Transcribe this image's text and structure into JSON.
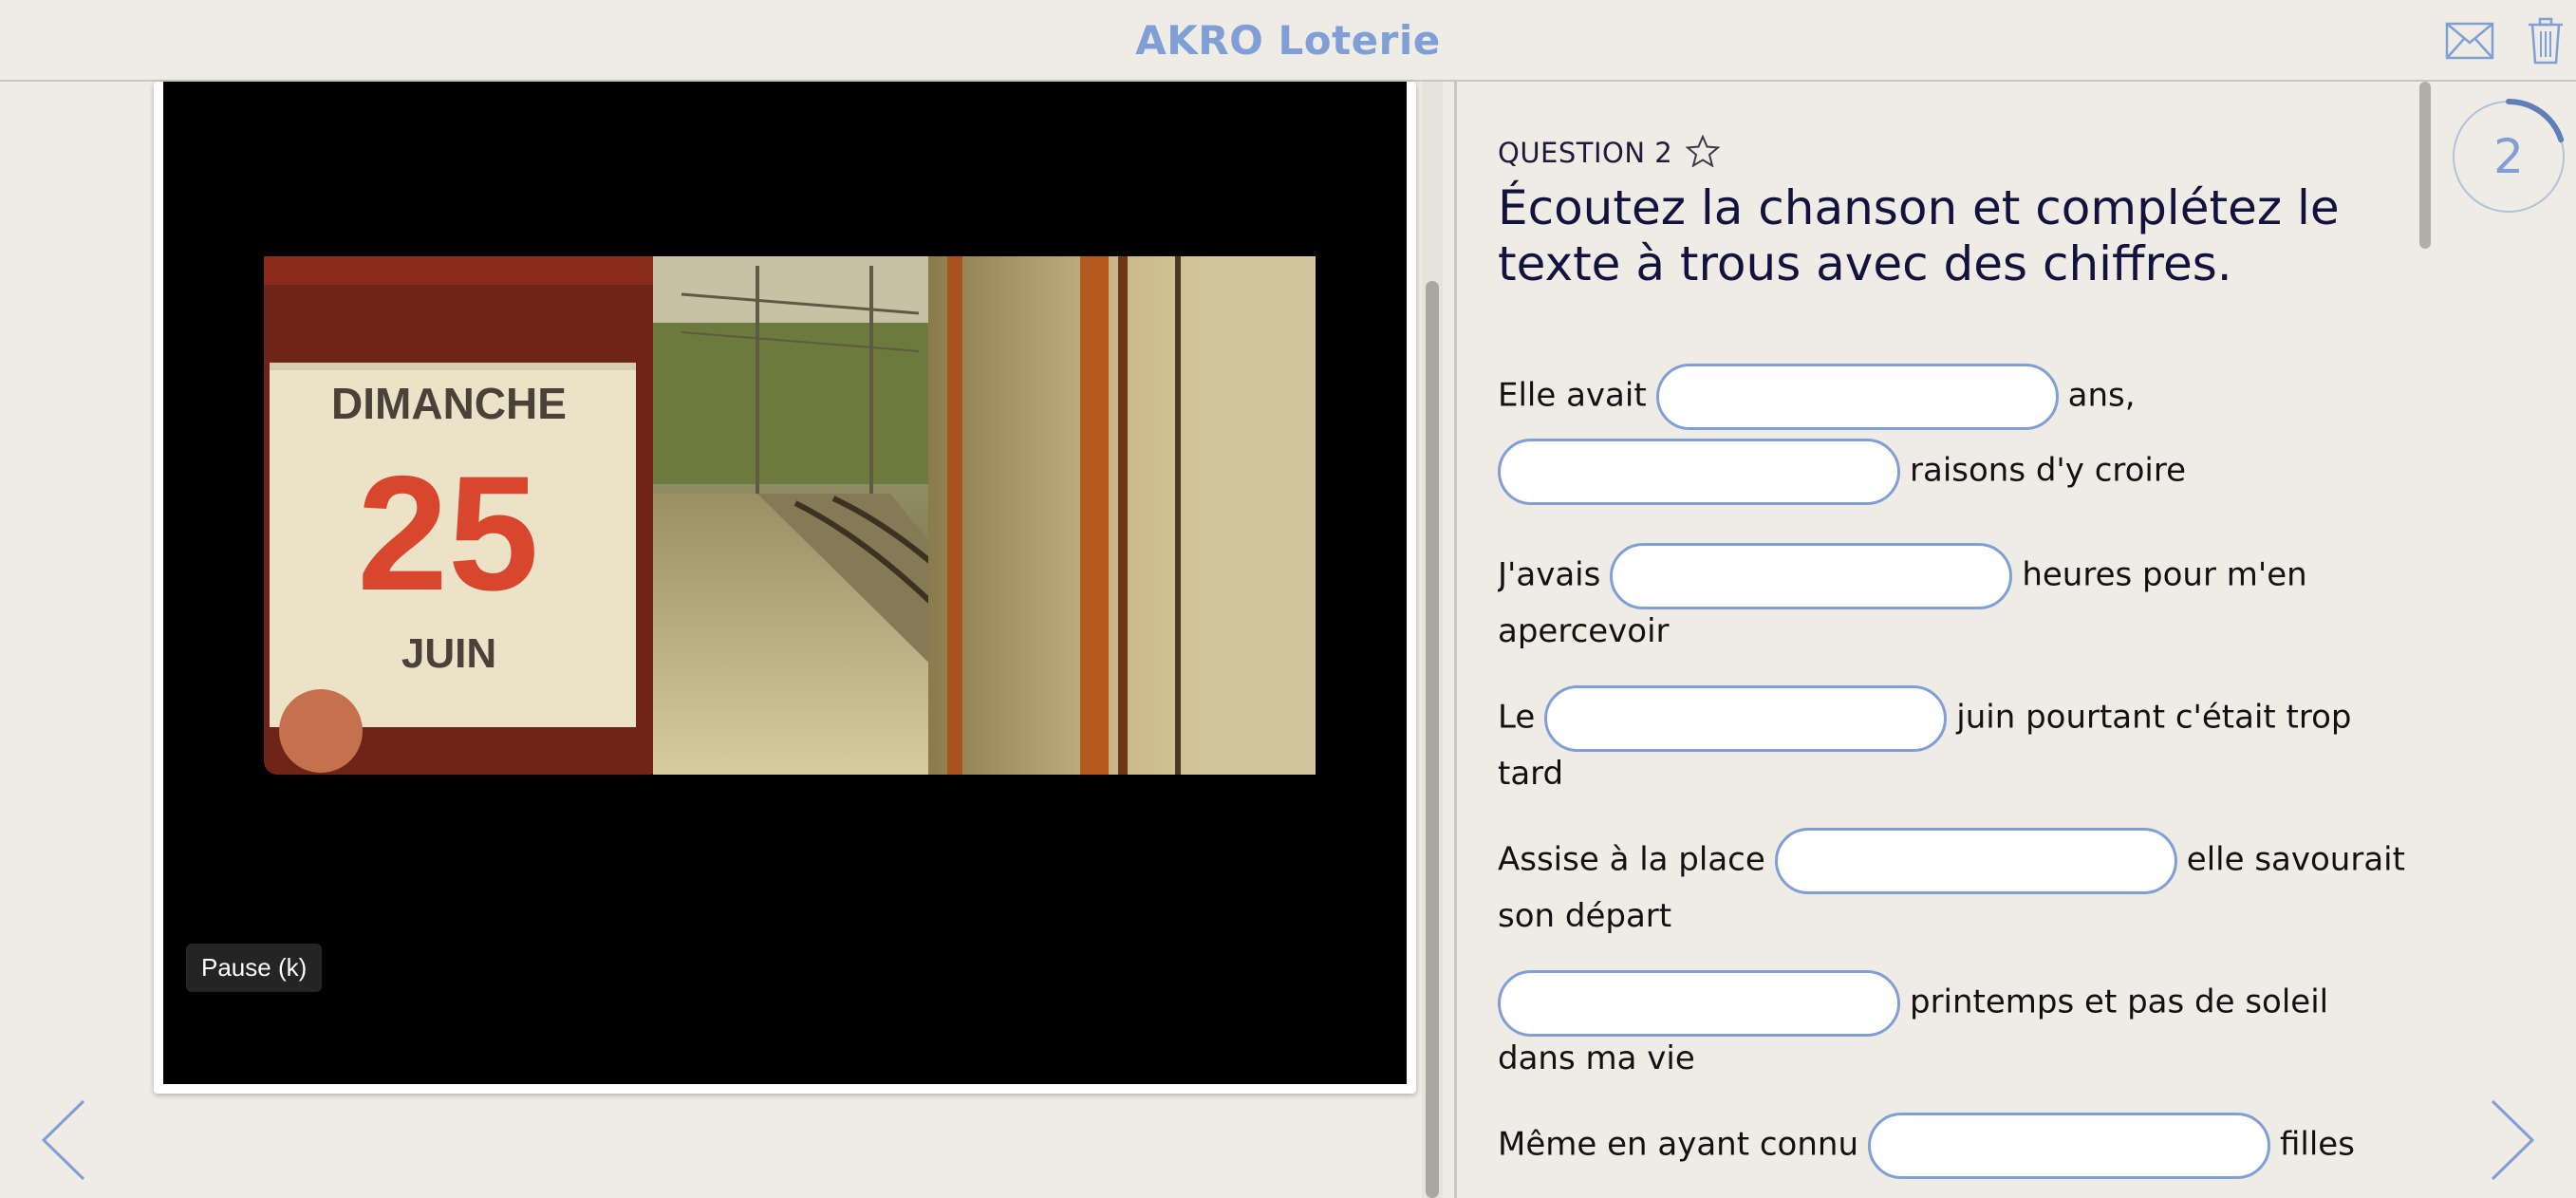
{
  "header": {
    "title": "AKRO Loterie",
    "mail_icon": "envelope-icon",
    "trash_icon": "trash-icon"
  },
  "video": {
    "tooltip": "Pause (k)",
    "calendar": {
      "day": "DIMANCHE",
      "date": "25",
      "month": "JUIN"
    }
  },
  "question": {
    "label": "QUESTION 2",
    "title": "Écoutez la chanson et complétez le texte à trous avec des chiffres.",
    "lines": [
      {
        "before": "Elle avait",
        "after": "ans,"
      },
      {
        "before": "",
        "after": "raisons d'y croire"
      },
      {
        "before": "J'avais",
        "after": "heures pour m'en"
      },
      {
        "cont": "apercevoir"
      },
      {
        "before": "Le",
        "after": "juin pourtant c'était trop"
      },
      {
        "cont": "tard"
      },
      {
        "before": "Assise à la place",
        "after": "elle savourait"
      },
      {
        "cont": "son départ"
      },
      {
        "before": "",
        "after": "printemps et pas de soleil"
      },
      {
        "cont": "dans ma vie"
      },
      {
        "before": "Même en ayant connu",
        "after": "filles"
      }
    ]
  },
  "progress": {
    "number": "2",
    "fraction": 0.2
  },
  "colors": {
    "accent": "#7f9fd6",
    "background": "#efece5",
    "title_text": "#12123e"
  }
}
